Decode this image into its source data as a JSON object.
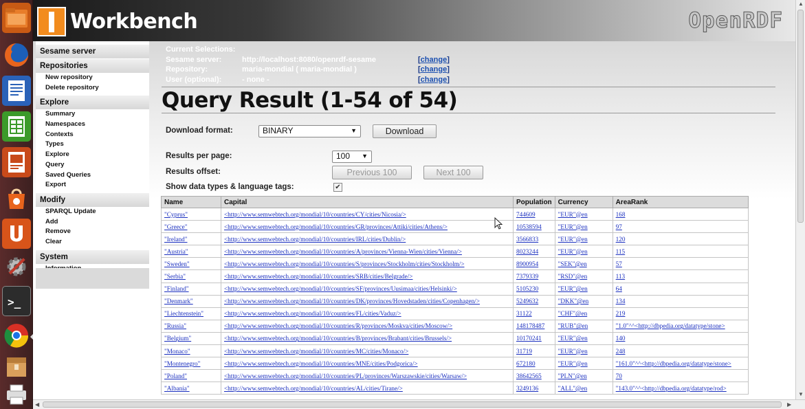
{
  "launcher": {
    "items": [
      {
        "name": "files-icon"
      },
      {
        "name": "firefox-icon"
      },
      {
        "name": "libreoffice-writer-icon"
      },
      {
        "name": "libreoffice-calc-icon"
      },
      {
        "name": "libreoffice-impress-icon"
      },
      {
        "name": "software-center-icon"
      },
      {
        "name": "ubuntu-one-icon"
      },
      {
        "name": "system-settings-icon"
      },
      {
        "name": "terminal-icon"
      },
      {
        "name": "chrome-icon"
      },
      {
        "name": "archive-icon"
      },
      {
        "name": "printer-icon"
      }
    ]
  },
  "header": {
    "app_title": "Workbench",
    "brand": "OpenRDF"
  },
  "nav": {
    "sections": [
      {
        "title": "Sesame server",
        "items": []
      },
      {
        "title": "Repositories",
        "items": [
          "New repository",
          "Delete repository"
        ]
      },
      {
        "title": "Explore",
        "items": [
          "Summary",
          "Namespaces",
          "Contexts",
          "Types",
          "Explore",
          "Query",
          "Saved Queries",
          "Export"
        ]
      },
      {
        "title": "Modify",
        "items": [
          "SPARQL Update",
          "Add",
          "Remove",
          "Clear"
        ]
      },
      {
        "title": "System",
        "items": [
          "Information"
        ]
      }
    ]
  },
  "selections": {
    "heading": "Current Selections:",
    "server_label": "Sesame server:",
    "server_value": "http://localhost:8080/openrdf-sesame",
    "repo_label": "Repository:",
    "repo_value": "maria-mondial ( maria-mondial )",
    "user_label": "User (optional):",
    "user_value": "- none -",
    "change_label": "change",
    "bracket_open": "[",
    "bracket_close": "]"
  },
  "page_title": "Query Result (1-54 of 54)",
  "form": {
    "download_format_label": "Download format:",
    "download_format_value": "BINARY",
    "download_button": "Download",
    "results_per_page_label": "Results per page:",
    "results_per_page_value": "100",
    "results_offset_label": "Results offset:",
    "previous_button": "Previous 100",
    "next_button": "Next 100",
    "show_types_label": "Show data types & language tags:",
    "show_types_checked": true
  },
  "table": {
    "columns": [
      "Name",
      "Capital",
      "Population",
      "Currency",
      "AreaRank"
    ],
    "rows": [
      [
        "\"Cyprus\"",
        "<http://www.semwebtech.org/mondial/10/countries/CY/cities/Nicosia/>",
        "744609",
        "\"EUR\"@en",
        "168"
      ],
      [
        "\"Greece\"",
        "<http://www.semwebtech.org/mondial/10/countries/GR/provinces/Attiki/cities/Athens/>",
        "10538594",
        "\"EUR\"@en",
        "97"
      ],
      [
        "\"Ireland\"",
        "<http://www.semwebtech.org/mondial/10/countries/IRL/cities/Dublin/>",
        "3566833",
        "\"EUR\"@en",
        "120"
      ],
      [
        "\"Austria\"",
        "<http://www.semwebtech.org/mondial/10/countries/A/provinces/Vienna-Wien/cities/Vienna/>",
        "8023244",
        "\"EUR\"@en",
        "115"
      ],
      [
        "\"Sweden\"",
        "<http://www.semwebtech.org/mondial/10/countries/S/provinces/Stockholm/cities/Stockholm/>",
        "8900954",
        "\"SEK\"@en",
        "57"
      ],
      [
        "\"Serbia\"",
        "<http://www.semwebtech.org/mondial/10/countries/SRB/cities/Belgrade/>",
        "7379339",
        "\"RSD\"@en",
        "113"
      ],
      [
        "\"Finland\"",
        "<http://www.semwebtech.org/mondial/10/countries/SF/provinces/Uusimaa/cities/Helsinki/>",
        "5105230",
        "\"EUR\"@en",
        "64"
      ],
      [
        "\"Denmark\"",
        "<http://www.semwebtech.org/mondial/10/countries/DK/provinces/Hovedstaden/cities/Copenhagen/>",
        "5249632",
        "\"DKK\"@en",
        "134"
      ],
      [
        "\"Liechtenstein\"",
        "<http://www.semwebtech.org/mondial/10/countries/FL/cities/Vaduz/>",
        "31122",
        "\"CHF\"@en",
        "219"
      ],
      [
        "\"Russia\"",
        "<http://www.semwebtech.org/mondial/10/countries/R/provinces/Moskva/cities/Moscow/>",
        "148178487",
        "\"RUB\"@en",
        "\"1.0\"^^<http://dbpedia.org/datatype/stone>"
      ],
      [
        "\"Belgium\"",
        "<http://www.semwebtech.org/mondial/10/countries/B/provinces/Brabant/cities/Brussels/>",
        "10170241",
        "\"EUR\"@en",
        "140"
      ],
      [
        "\"Monaco\"",
        "<http://www.semwebtech.org/mondial/10/countries/MC/cities/Monaco/>",
        "31719",
        "\"EUR\"@en",
        "248"
      ],
      [
        "\"Montenegro\"",
        "<http://www.semwebtech.org/mondial/10/countries/MNE/cities/Podgorica/>",
        "672180",
        "\"EUR\"@en",
        "\"161.0\"^^<http://dbpedia.org/datatype/stone>"
      ],
      [
        "\"Poland\"",
        "<http://www.semwebtech.org/mondial/10/countries/PL/provinces/Warszawskie/cities/Warsaw/>",
        "38642565",
        "\"PLN\"@en",
        "70"
      ],
      [
        "\"Albania\"",
        "<http://www.semwebtech.org/mondial/10/countries/AL/cities/Tirane/>",
        "3249136",
        "\"ALL\"@en",
        "\"143.0\"^^<http://dbpedia.org/datatype/rod>"
      ]
    ]
  },
  "colors": {
    "accent": "#f28c1e",
    "link": "#1a2fbf",
    "launcher_bg": "#4a2424"
  }
}
